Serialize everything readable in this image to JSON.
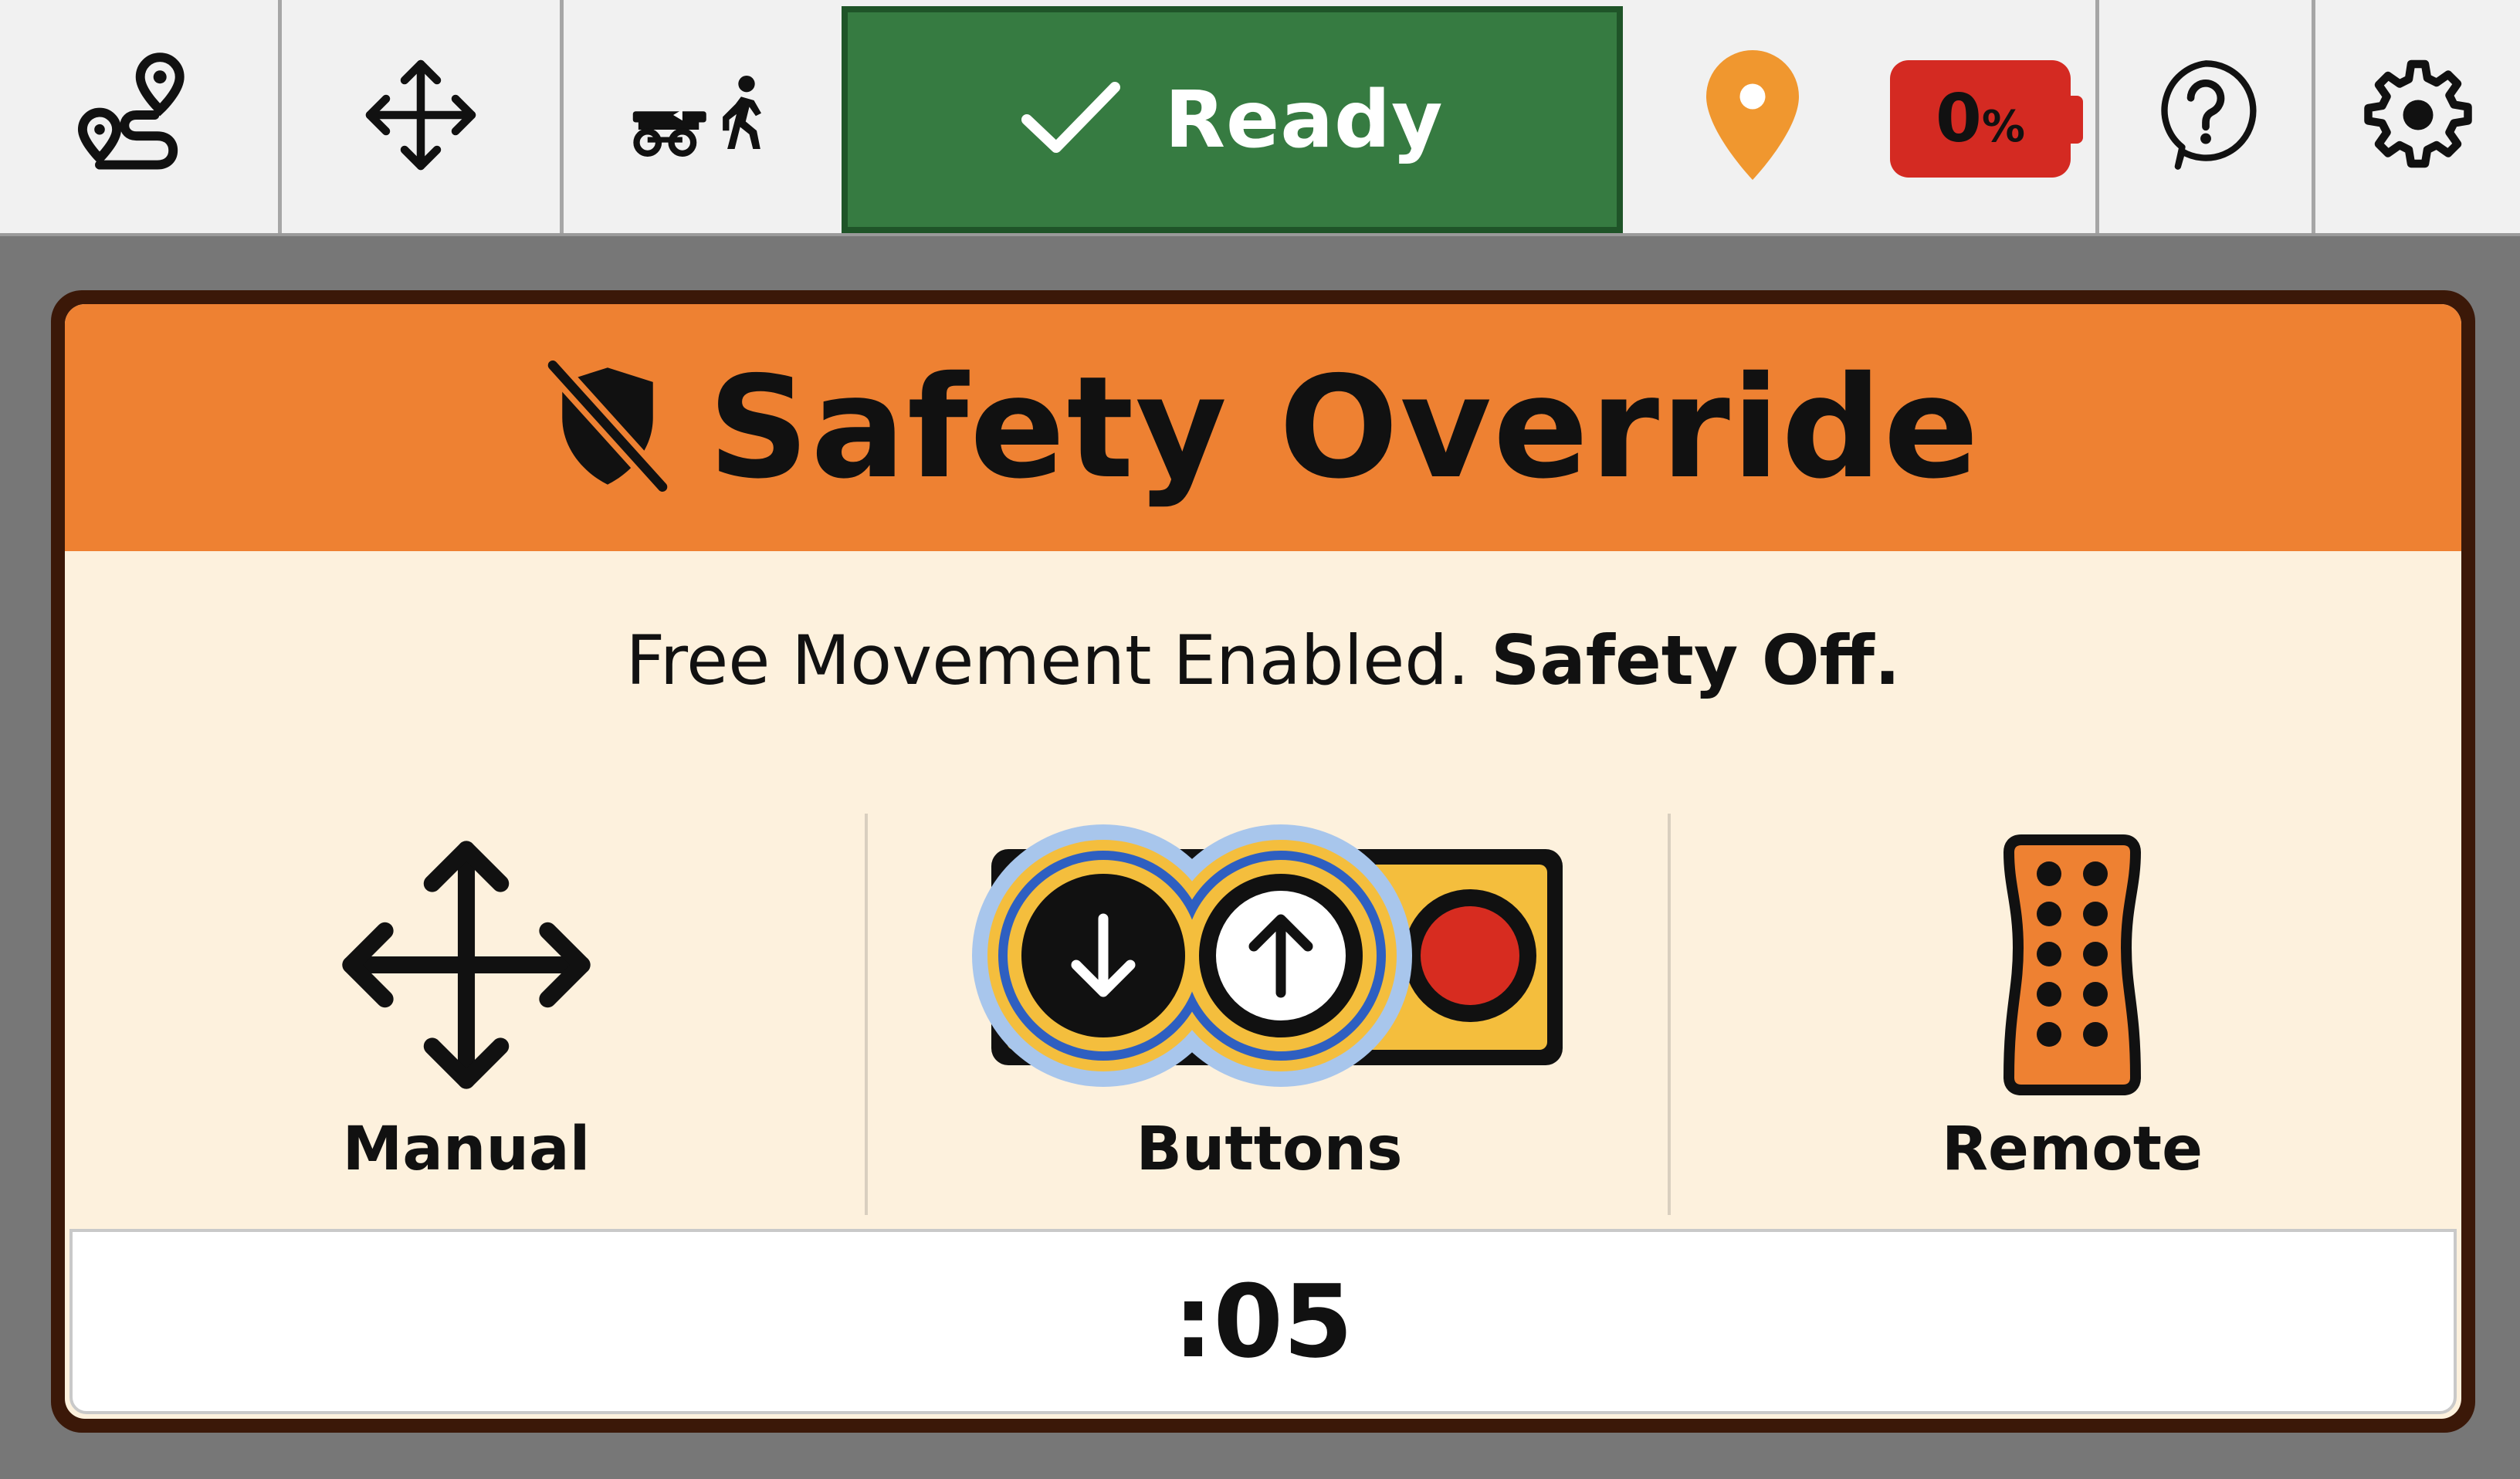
{
  "topbar": {
    "route_icon": "route-map-icon",
    "move_icon": "move-arrows-icon",
    "follow_icon": "cart-follow-walker-icon",
    "status_label": "Ready",
    "status_color": "#367b41",
    "location_icon": "location-pin-icon",
    "location_color": "#f0972f",
    "battery_value": "0",
    "battery_unit": "%",
    "battery_color": "#d42a22",
    "help_icon": "help-question-icon",
    "settings_icon": "gear-icon"
  },
  "modal": {
    "title": "Safety Override",
    "title_icon": "shield-off-icon",
    "header_color": "#ee8132",
    "subtitle_normal": "Free Movement Enabled.",
    "subtitle_bold": "Safety Off.",
    "options": [
      {
        "label": "Manual",
        "icon": "move-arrows-icon"
      },
      {
        "label": "Buttons",
        "icon": "button-panel-icon"
      },
      {
        "label": "Remote",
        "icon": "remote-control-icon"
      }
    ],
    "timer": ":05"
  }
}
